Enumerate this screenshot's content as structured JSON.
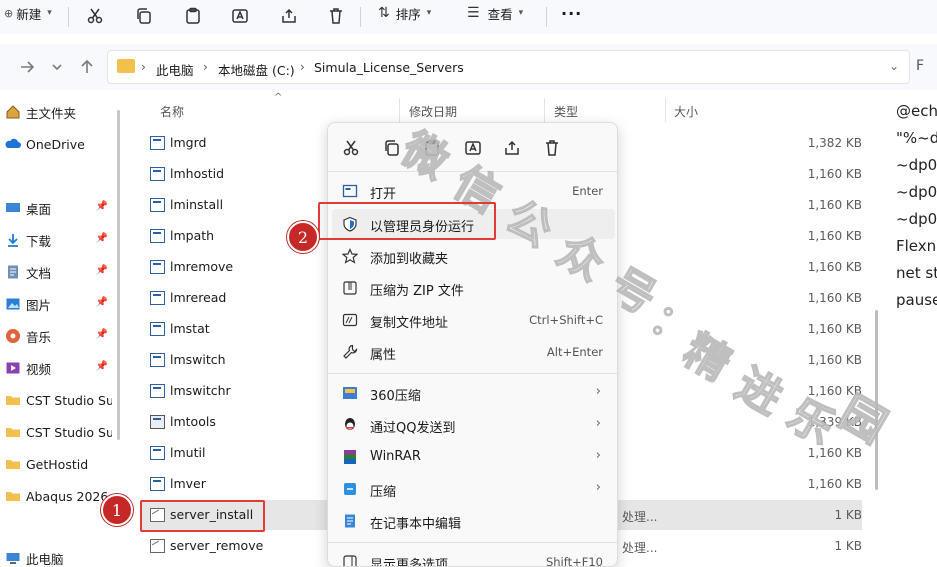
{
  "toolbar": {
    "new_label": "新建",
    "sort_label": "排序",
    "view_label": "查看",
    "more_label": "···"
  },
  "address": {
    "crumbs": [
      "此电脑",
      "本地磁盘 (C:)",
      "Simula_License_Servers"
    ],
    "separator": "›"
  },
  "nav": {
    "items": [
      {
        "label": "主文件夹",
        "icon": "home-icon"
      },
      {
        "label": "OneDrive",
        "icon": "cloud-icon"
      },
      {
        "label": "桌面",
        "icon": "desktop-icon",
        "pinned": true
      },
      {
        "label": "下载",
        "icon": "download-icon",
        "pinned": true
      },
      {
        "label": "文档",
        "icon": "document-icon",
        "pinned": true
      },
      {
        "label": "图片",
        "icon": "picture-icon",
        "pinned": true
      },
      {
        "label": "音乐",
        "icon": "music-icon",
        "pinned": true
      },
      {
        "label": "视频",
        "icon": "video-icon",
        "pinned": true
      },
      {
        "label": "CST Studio Sui",
        "icon": "folder-icon"
      },
      {
        "label": "CST Studio Sui",
        "icon": "folder-icon"
      },
      {
        "label": "GetHostid",
        "icon": "folder-icon"
      },
      {
        "label": "Abaqus 2026",
        "icon": "folder-icon"
      },
      {
        "label": "此电脑",
        "icon": "computer-icon"
      }
    ],
    "pin_glyph": "📌"
  },
  "columns": {
    "name": "名称",
    "modified": "修改日期",
    "type": "类型",
    "size": "大小"
  },
  "files": [
    {
      "name": "lmgrd",
      "type": "",
      "size": "1,382 KB",
      "kind": "exe"
    },
    {
      "name": "lmhostid",
      "type": "",
      "size": "1,160 KB",
      "kind": "exe"
    },
    {
      "name": "lminstall",
      "type": "",
      "size": "1,160 KB",
      "kind": "exe"
    },
    {
      "name": "lmpath",
      "type": "",
      "size": "1,160 KB",
      "kind": "exe"
    },
    {
      "name": "lmremove",
      "type": "",
      "size": "1,160 KB",
      "kind": "exe"
    },
    {
      "name": "lmreread",
      "type": "",
      "size": "1,160 KB",
      "kind": "exe"
    },
    {
      "name": "lmstat",
      "type": "",
      "size": "1,160 KB",
      "kind": "exe"
    },
    {
      "name": "lmswitch",
      "type": "",
      "size": "1,160 KB",
      "kind": "exe"
    },
    {
      "name": "lmswitchr",
      "type": "",
      "size": "1,160 KB",
      "kind": "exe"
    },
    {
      "name": "lmtools",
      "type": "",
      "size": "1,339 KB",
      "kind": "tool"
    },
    {
      "name": "lmutil",
      "type": "",
      "size": "1,160 KB",
      "kind": "exe"
    },
    {
      "name": "lmver",
      "type": "",
      "size": "1,160 KB",
      "kind": "exe"
    },
    {
      "name": "server_install",
      "type": "处理...",
      "size": "1 KB",
      "kind": "script",
      "selected": true
    },
    {
      "name": "server_remove",
      "type": "处理...",
      "size": "1 KB",
      "kind": "script"
    }
  ],
  "preview": {
    "lines": [
      "@ech",
      "\"%~d",
      "~dp0",
      "~dp0",
      "~dp0",
      "Flexn",
      "net st",
      "pause"
    ]
  },
  "context_menu": {
    "items": [
      {
        "label": "打开",
        "shortcut": "Enter",
        "icon": "open-icon"
      },
      {
        "label": "以管理员身份运行",
        "shortcut": "",
        "icon": "shield-icon"
      },
      {
        "label": "添加到收藏夹",
        "shortcut": "",
        "icon": "star-icon"
      },
      {
        "label": "压缩为 ZIP 文件",
        "shortcut": "",
        "icon": "zip-icon"
      },
      {
        "label": "复制文件地址",
        "shortcut": "Ctrl+Shift+C",
        "icon": "copy-path-icon"
      },
      {
        "label": "属性",
        "shortcut": "Alt+Enter",
        "icon": "wrench-icon"
      },
      {
        "label": "360压缩",
        "shortcut": "",
        "icon": "compress-360-icon",
        "submenu": true
      },
      {
        "label": "通过QQ发送到",
        "shortcut": "",
        "icon": "qq-icon",
        "submenu": true
      },
      {
        "label": "WinRAR",
        "shortcut": "",
        "icon": "winrar-icon",
        "submenu": true
      },
      {
        "label": "压缩",
        "shortcut": "",
        "icon": "archive-icon",
        "submenu": true
      },
      {
        "label": "在记事本中编辑",
        "shortcut": "",
        "icon": "notepad-icon"
      },
      {
        "label": "显示更多选项",
        "shortcut": "Shift+F10",
        "icon": "more-options-icon"
      }
    ],
    "submenu_arrow": "›"
  },
  "annotations": {
    "marker_1": "1",
    "marker_2": "2"
  },
  "watermark": {
    "chars": [
      "微",
      "信",
      "公",
      "众",
      "号",
      "：",
      "精",
      "进",
      "乐",
      "园"
    ]
  }
}
